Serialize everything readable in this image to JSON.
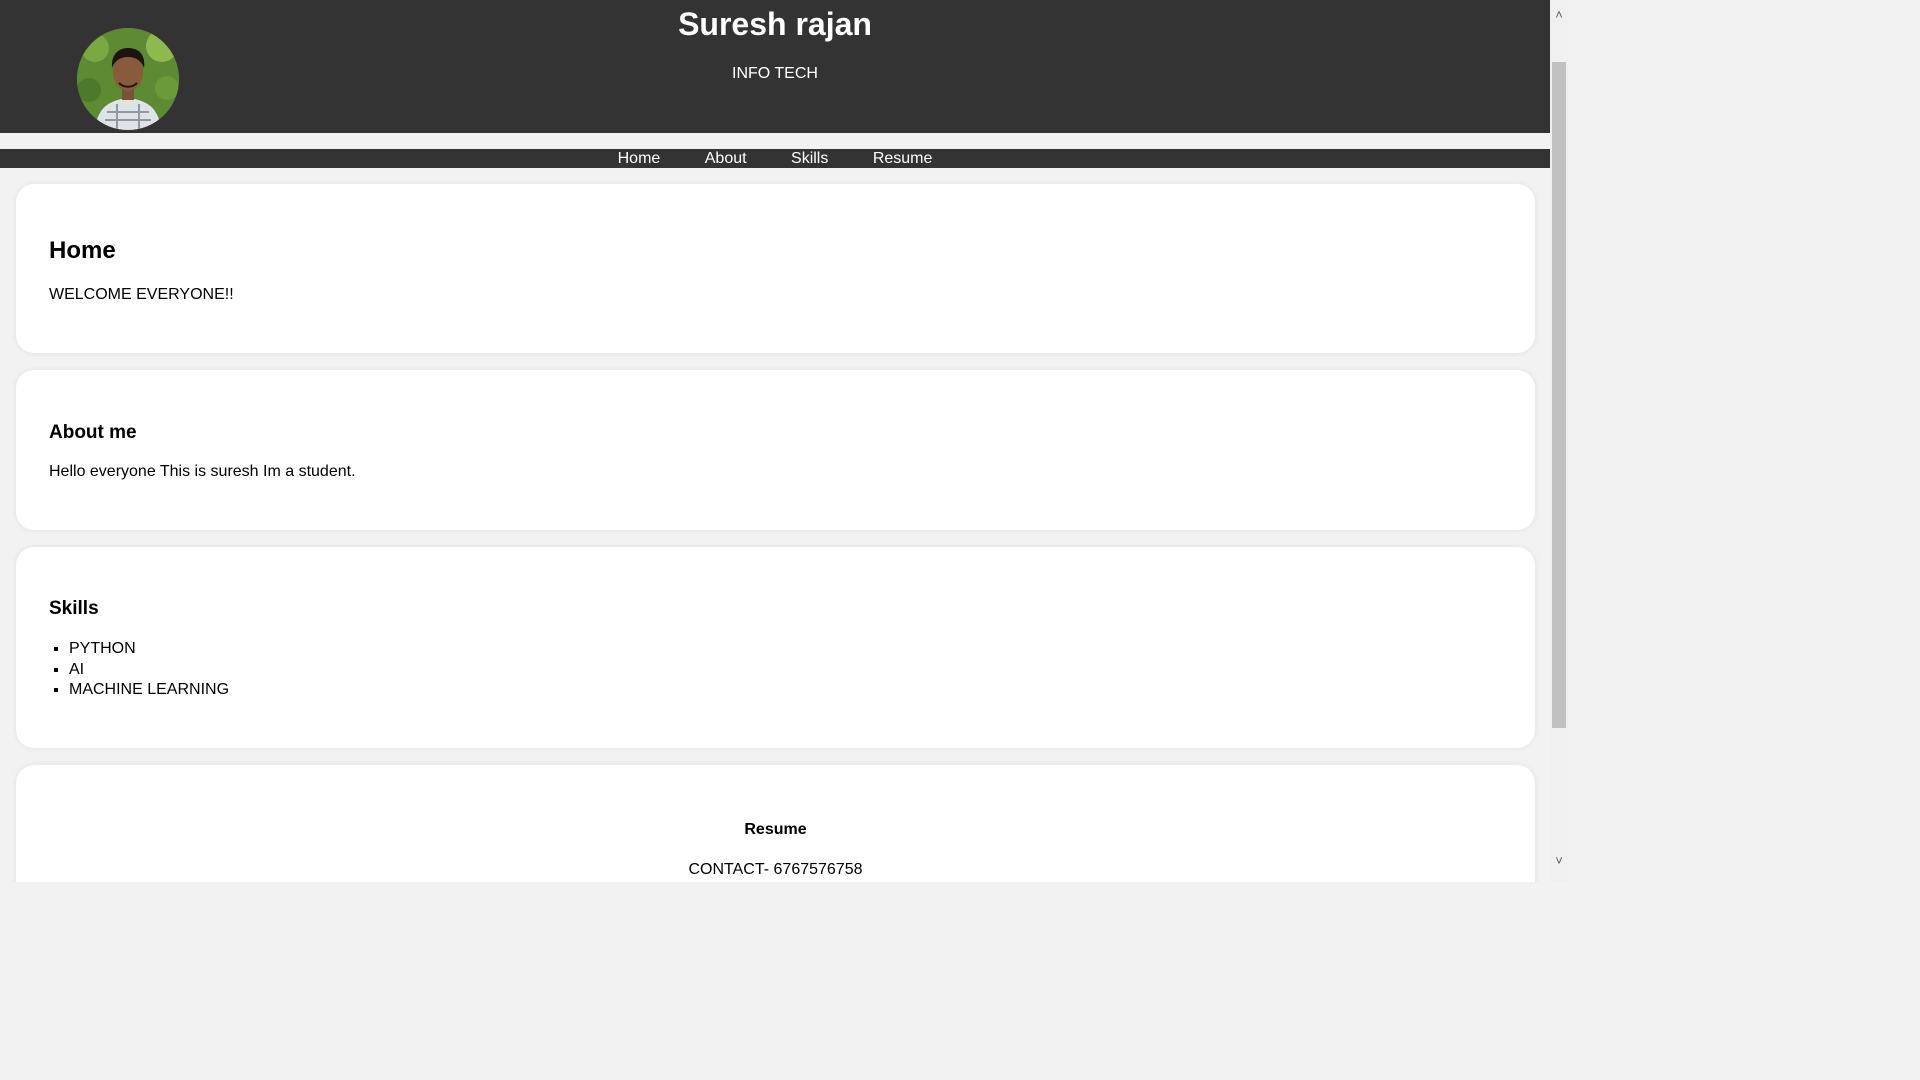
{
  "header": {
    "title": "Suresh rajan",
    "subtitle": "INFO TECH",
    "avatar_icon": "profile-photo"
  },
  "nav": {
    "items": [
      "Home",
      "About",
      "Skills",
      "Resume"
    ]
  },
  "home": {
    "heading": "Home",
    "text": "WELCOME EVERYONE!!"
  },
  "about": {
    "heading": "About me",
    "text": "Hello everyone This is suresh Im a student."
  },
  "skills": {
    "heading": "Skills",
    "items": [
      "PYTHON",
      "AI",
      "MACHINE LEARNING"
    ]
  },
  "resume": {
    "heading": "Resume",
    "contact": "CONTACT- 6767576758"
  },
  "colors": {
    "header_bg": "#333333",
    "page_bg": "#f2f2f2",
    "card_bg": "#ffffff",
    "nav_text": "#ffffff"
  },
  "scrollbar": {
    "up_icon": "chevron-up-icon",
    "down_icon": "chevron-down-icon"
  }
}
